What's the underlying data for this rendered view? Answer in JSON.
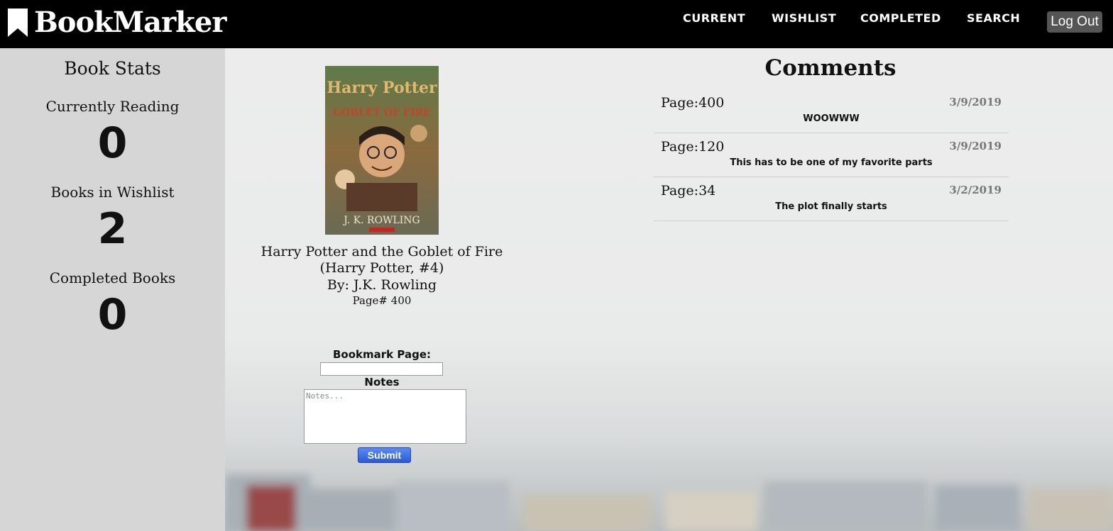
{
  "brand": {
    "name": "BookMarker",
    "icon": "bookmark-icon"
  },
  "nav": {
    "items": [
      "CURRENT",
      "WISHLIST",
      "COMPLETED",
      "SEARCH"
    ],
    "logout_label": "Log Out"
  },
  "sidebar": {
    "title": "Book Stats",
    "stats": [
      {
        "label": "Currently Reading",
        "value": "0"
      },
      {
        "label": "Books in Wishlist",
        "value": "2"
      },
      {
        "label": "Completed Books",
        "value": "0"
      }
    ]
  },
  "book": {
    "title": "Harry Potter and the Goblet of Fire (Harry Potter, #4)",
    "author": "By: J.K. Rowling",
    "page": "Page# 400",
    "cover_text": {
      "top": "Harry Potter",
      "middle": "GOBLET OF FIRE",
      "bottom": "J. K. ROWLING"
    }
  },
  "form": {
    "bookmark_label": "Bookmark Page:",
    "notes_label": "Notes",
    "notes_placeholder": "Notes...",
    "submit_label": "Submit"
  },
  "comments": {
    "title": "Comments",
    "items": [
      {
        "page": "Page:400",
        "date": "3/9/2019",
        "text": "WOOWWW"
      },
      {
        "page": "Page:120",
        "date": "3/9/2019",
        "text": "This has to be one of my favorite parts"
      },
      {
        "page": "Page:34",
        "date": "3/2/2019",
        "text": "The plot finally starts"
      }
    ]
  },
  "colors": {
    "nav_bg": "#000000",
    "sidebar_bg": "#d6d6d6",
    "button_blue": "#3a66e0",
    "logout_bg": "#555555"
  }
}
